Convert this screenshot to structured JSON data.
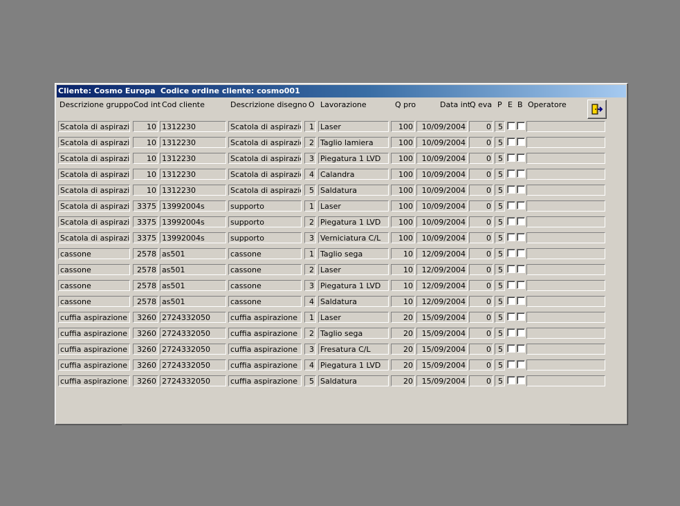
{
  "window": {
    "client_label": "Cliente: Cosmo Europa",
    "order_label": "Codice ordine cliente: cosmo001"
  },
  "headers": {
    "descrizione_gruppo": "Descrizione gruppo",
    "cod_int": "Cod int",
    "cod_cliente": "Cod cliente",
    "descrizione_disegno": "Descrizione disegno",
    "o": "O",
    "lavorazione": "Lavorazione",
    "q_pro": "Q pro",
    "data_int": "Data int",
    "q_eva": "Q eva",
    "p": "P",
    "e": "E",
    "b": "B",
    "operatore": "Operatore"
  },
  "exit_button": {
    "icon": "exit-door-icon"
  },
  "rows": [
    {
      "gruppo": "Scatola di aspirazione",
      "cod_int": "10",
      "cod_cliente": "1312230",
      "disegno": "Scatola di aspirazione",
      "o": "1",
      "lavorazione": "Laser",
      "q_pro": "100",
      "data_int": "10/09/2004",
      "q_eva": "0",
      "p": "5",
      "operatore": ""
    },
    {
      "gruppo": "Scatola di aspirazione",
      "cod_int": "10",
      "cod_cliente": "1312230",
      "disegno": "Scatola di aspirazione",
      "o": "2",
      "lavorazione": "Taglio lamiera",
      "q_pro": "100",
      "data_int": "10/09/2004",
      "q_eva": "0",
      "p": "5",
      "operatore": ""
    },
    {
      "gruppo": "Scatola di aspirazione",
      "cod_int": "10",
      "cod_cliente": "1312230",
      "disegno": "Scatola di aspirazione",
      "o": "3",
      "lavorazione": "Piegatura 1 LVD",
      "q_pro": "100",
      "data_int": "10/09/2004",
      "q_eva": "0",
      "p": "5",
      "operatore": ""
    },
    {
      "gruppo": "Scatola di aspirazione",
      "cod_int": "10",
      "cod_cliente": "1312230",
      "disegno": "Scatola di aspirazione",
      "o": "4",
      "lavorazione": "Calandra",
      "q_pro": "100",
      "data_int": "10/09/2004",
      "q_eva": "0",
      "p": "5",
      "operatore": ""
    },
    {
      "gruppo": "Scatola di aspirazione",
      "cod_int": "10",
      "cod_cliente": "1312230",
      "disegno": "Scatola di aspirazione",
      "o": "5",
      "lavorazione": "Saldatura",
      "q_pro": "100",
      "data_int": "10/09/2004",
      "q_eva": "0",
      "p": "5",
      "operatore": ""
    },
    {
      "gruppo": "Scatola di aspirazione",
      "cod_int": "3375",
      "cod_cliente": "13992004s",
      "disegno": "supporto",
      "o": "1",
      "lavorazione": "Laser",
      "q_pro": "100",
      "data_int": "10/09/2004",
      "q_eva": "0",
      "p": "5",
      "operatore": ""
    },
    {
      "gruppo": "Scatola di aspirazione",
      "cod_int": "3375",
      "cod_cliente": "13992004s",
      "disegno": "supporto",
      "o": "2",
      "lavorazione": "Piegatura 1 LVD",
      "q_pro": "100",
      "data_int": "10/09/2004",
      "q_eva": "0",
      "p": "5",
      "operatore": ""
    },
    {
      "gruppo": "Scatola di aspirazione",
      "cod_int": "3375",
      "cod_cliente": "13992004s",
      "disegno": "supporto",
      "o": "3",
      "lavorazione": "Verniciatura C/L",
      "q_pro": "100",
      "data_int": "10/09/2004",
      "q_eva": "0",
      "p": "5",
      "operatore": ""
    },
    {
      "gruppo": "cassone",
      "cod_int": "2578",
      "cod_cliente": "as501",
      "disegno": "cassone",
      "o": "1",
      "lavorazione": "Taglio sega",
      "q_pro": "10",
      "data_int": "12/09/2004",
      "q_eva": "0",
      "p": "5",
      "operatore": ""
    },
    {
      "gruppo": "cassone",
      "cod_int": "2578",
      "cod_cliente": "as501",
      "disegno": "cassone",
      "o": "2",
      "lavorazione": "Laser",
      "q_pro": "10",
      "data_int": "12/09/2004",
      "q_eva": "0",
      "p": "5",
      "operatore": ""
    },
    {
      "gruppo": "cassone",
      "cod_int": "2578",
      "cod_cliente": "as501",
      "disegno": "cassone",
      "o": "3",
      "lavorazione": "Piegatura 1 LVD",
      "q_pro": "10",
      "data_int": "12/09/2004",
      "q_eva": "0",
      "p": "5",
      "operatore": ""
    },
    {
      "gruppo": "cassone",
      "cod_int": "2578",
      "cod_cliente": "as501",
      "disegno": "cassone",
      "o": "4",
      "lavorazione": "Saldatura",
      "q_pro": "10",
      "data_int": "12/09/2004",
      "q_eva": "0",
      "p": "5",
      "operatore": ""
    },
    {
      "gruppo": "cuffia aspirazione",
      "cod_int": "3260",
      "cod_cliente": "2724332050",
      "disegno": "cuffia aspirazione",
      "o": "1",
      "lavorazione": "Laser",
      "q_pro": "20",
      "data_int": "15/09/2004",
      "q_eva": "0",
      "p": "5",
      "operatore": ""
    },
    {
      "gruppo": "cuffia aspirazione",
      "cod_int": "3260",
      "cod_cliente": "2724332050",
      "disegno": "cuffia aspirazione",
      "o": "2",
      "lavorazione": "Taglio sega",
      "q_pro": "20",
      "data_int": "15/09/2004",
      "q_eva": "0",
      "p": "5",
      "operatore": ""
    },
    {
      "gruppo": "cuffia aspirazione",
      "cod_int": "3260",
      "cod_cliente": "2724332050",
      "disegno": "cuffia aspirazione",
      "o": "3",
      "lavorazione": "Fresatura C/L",
      "q_pro": "20",
      "data_int": "15/09/2004",
      "q_eva": "0",
      "p": "5",
      "operatore": ""
    },
    {
      "gruppo": "cuffia aspirazione",
      "cod_int": "3260",
      "cod_cliente": "2724332050",
      "disegno": "cuffia aspirazione",
      "o": "4",
      "lavorazione": "Piegatura 1 LVD",
      "q_pro": "20",
      "data_int": "15/09/2004",
      "q_eva": "0",
      "p": "5",
      "operatore": ""
    },
    {
      "gruppo": "cuffia aspirazione",
      "cod_int": "3260",
      "cod_cliente": "2724332050",
      "disegno": "cuffia aspirazione",
      "o": "5",
      "lavorazione": "Saldatura",
      "q_pro": "20",
      "data_int": "15/09/2004",
      "q_eva": "0",
      "p": "5",
      "operatore": ""
    }
  ]
}
